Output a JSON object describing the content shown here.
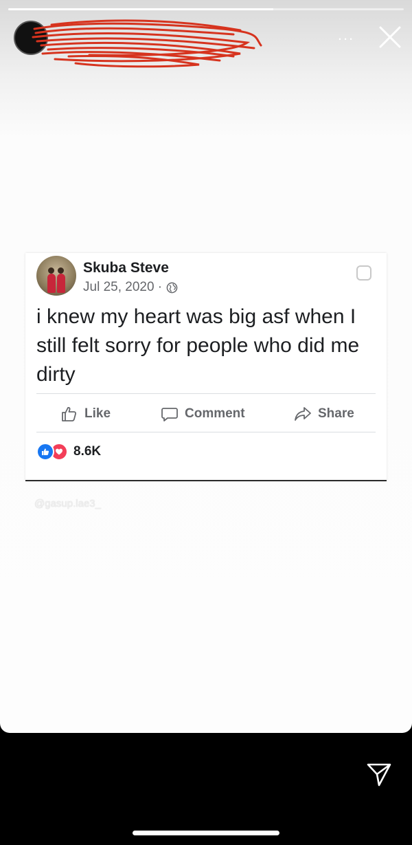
{
  "story": {
    "progress": 0.67,
    "watermark": "@gasup.lae3_"
  },
  "header": {
    "more_label": "...",
    "icons": {
      "close": "close-icon",
      "avatar": "avatar"
    }
  },
  "post": {
    "author": "Skuba Steve",
    "date": "Jul 25, 2020 ·",
    "text": "i knew my heart was big asf when I still felt sorry for people who did me dirty",
    "actions": {
      "like": "Like",
      "comment": "Comment",
      "share": "Share"
    },
    "reaction_count": "8.6K"
  },
  "colors": {
    "like_blue": "#1877f2",
    "love_red": "#f33e58",
    "redaction_red": "#d6331e"
  }
}
